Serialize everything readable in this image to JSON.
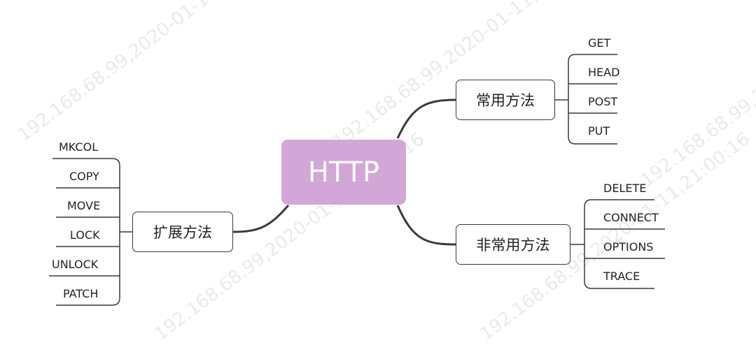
{
  "watermark": "192.168.68.99,2020-01-11,21:00:16",
  "root": {
    "label": "HTTP",
    "color": "#d3a6d8"
  },
  "branches": {
    "common": {
      "label": "常用方法",
      "leaves": [
        "GET",
        "HEAD",
        "POST",
        "PUT"
      ]
    },
    "uncommon": {
      "label": "非常用方法",
      "leaves": [
        "DELETE",
        "CONNECT",
        "OPTIONS",
        "TRACE"
      ]
    },
    "extended": {
      "label": "扩展方法",
      "leaves": [
        "MKCOL",
        "COPY",
        "MOVE",
        "LOCK",
        "UNLOCK",
        "PATCH"
      ]
    }
  }
}
